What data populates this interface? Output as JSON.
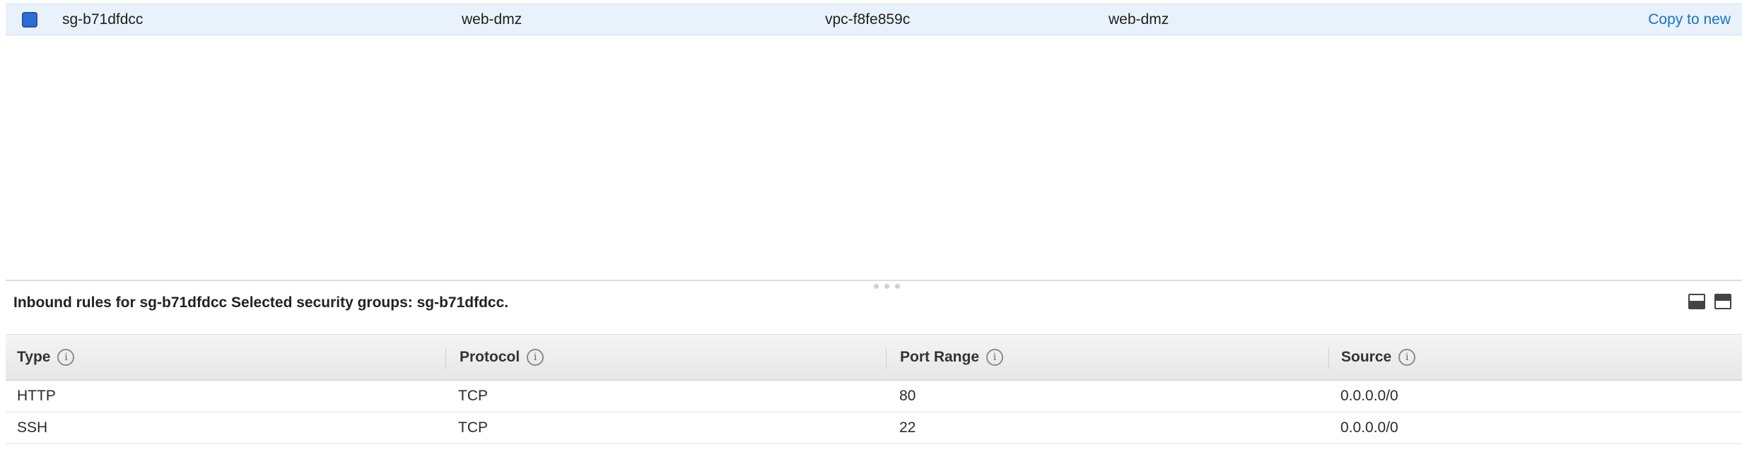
{
  "security_group_row": {
    "group_id": "sg-b71dfdcc",
    "group_name": "web-dmz",
    "vpc_id": "vpc-f8fe859c",
    "description": "web-dmz",
    "action_link": "Copy to new"
  },
  "inbound": {
    "title": "Inbound rules for sg-b71dfdcc Selected security groups: sg-b71dfdcc.",
    "columns": [
      "Type",
      "Protocol",
      "Port Range",
      "Source"
    ],
    "info_glyph": "i",
    "rows": [
      {
        "type": "HTTP",
        "protocol": "TCP",
        "port_range": "80",
        "source": "0.0.0.0/0"
      },
      {
        "type": "SSH",
        "protocol": "TCP",
        "port_range": "22",
        "source": "0.0.0.0/0"
      }
    ]
  },
  "icons": {
    "checkbox": "checkbox-checked-icon",
    "info": "info-icon",
    "panel_bottom": "panel-bottom-icon",
    "panel_top": "panel-top-icon"
  },
  "colors": {
    "selected_row": "#e9f2fb",
    "checkbox": "#2c6cd6",
    "link": "#1a73c8"
  }
}
